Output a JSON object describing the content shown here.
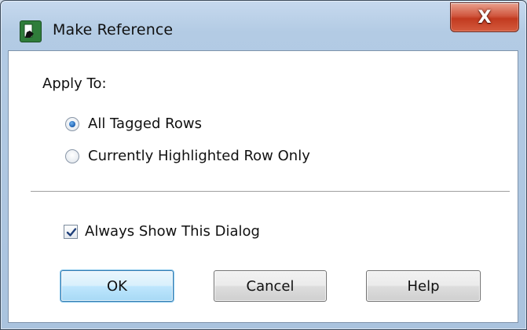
{
  "window": {
    "title": "Make Reference",
    "close_label": "X",
    "icon": "app-document-icon"
  },
  "dialog": {
    "apply_to_label": "Apply To:",
    "options": [
      {
        "label": "All Tagged Rows",
        "selected": true
      },
      {
        "label": "Currently Highlighted Row Only",
        "selected": false
      }
    ],
    "always_show": {
      "label": "Always Show This Dialog",
      "checked": true
    },
    "buttons": {
      "ok": "OK",
      "cancel": "Cancel",
      "help": "Help"
    }
  },
  "colors": {
    "accent": "#3c7fb1",
    "close_button": "#c23a20",
    "icon_green": "#2f7d3a"
  }
}
